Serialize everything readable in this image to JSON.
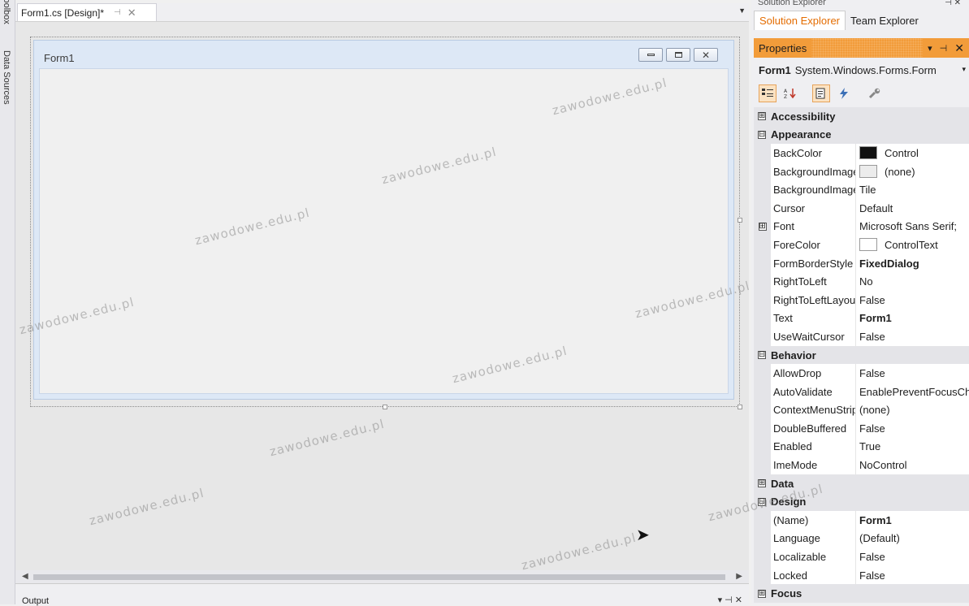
{
  "left_strip": {
    "tab1": "Toolbox",
    "tab2": "Data Sources"
  },
  "document_tab": {
    "title": "Form1.cs [Design]*",
    "pin_glyph": "⊣",
    "close_glyph": "✕",
    "dropdown_glyph": "▼"
  },
  "form": {
    "title": "Form1",
    "minimize_icon": "minimize-icon",
    "maximize_icon": "maximize-icon",
    "close_glyph": "✕"
  },
  "scrollbar": {
    "left_glyph": "◀",
    "right_glyph": "▶"
  },
  "output": {
    "title": "Output",
    "controls": "▾ ⊣ ✕"
  },
  "solution_explorer": {
    "header": "Solution Explorer",
    "header_ctrls": "⊣ ✕",
    "tabs": [
      "Solution Explorer",
      "Team Explorer"
    ]
  },
  "properties": {
    "title": "Properties",
    "header_ctrls": {
      "dropdown": "▾",
      "pin": "⊣",
      "close": "✕"
    },
    "object_name": "Form1",
    "object_type": "System.Windows.Forms.Form",
    "object_arrow": "▾",
    "toolbar": {
      "categorized_icon": "categorized-icon",
      "alphabetical_icon": "alphabetical-icon",
      "properties_icon": "properties-icon",
      "events_icon": "events-icon",
      "property_pages_icon": "wrench-icon"
    },
    "rows": [
      {
        "kind": "cat",
        "name": "Accessibility",
        "expander": "⊞"
      },
      {
        "kind": "cat",
        "name": "Appearance",
        "expander": "⊟"
      },
      {
        "kind": "prop",
        "name": "BackColor",
        "value": "Control",
        "swatch": "black"
      },
      {
        "kind": "prop",
        "name": "BackgroundImage",
        "value": "(none)",
        "swatch": "empty"
      },
      {
        "kind": "prop",
        "name": "BackgroundImageLayout",
        "value": "Tile"
      },
      {
        "kind": "prop",
        "name": "Cursor",
        "value": "Default"
      },
      {
        "kind": "prop",
        "name": "Font",
        "value": "Microsoft Sans Serif;",
        "expandable": true
      },
      {
        "kind": "prop",
        "name": "ForeColor",
        "value": "ControlText",
        "swatch": "white"
      },
      {
        "kind": "prop",
        "name": "FormBorderStyle",
        "value": "FixedDialog",
        "bold": true
      },
      {
        "kind": "prop",
        "name": "RightToLeft",
        "value": "No"
      },
      {
        "kind": "prop",
        "name": "RightToLeftLayout",
        "value": "False"
      },
      {
        "kind": "prop",
        "name": "Text",
        "value": "Form1",
        "bold": true
      },
      {
        "kind": "prop",
        "name": "UseWaitCursor",
        "value": "False"
      },
      {
        "kind": "cat",
        "name": "Behavior",
        "expander": "⊟"
      },
      {
        "kind": "prop",
        "name": "AllowDrop",
        "value": "False"
      },
      {
        "kind": "prop",
        "name": "AutoValidate",
        "value": "EnablePreventFocusChange"
      },
      {
        "kind": "prop",
        "name": "ContextMenuStrip",
        "value": "(none)"
      },
      {
        "kind": "prop",
        "name": "DoubleBuffered",
        "value": "False"
      },
      {
        "kind": "prop",
        "name": "Enabled",
        "value": "True"
      },
      {
        "kind": "prop",
        "name": "ImeMode",
        "value": "NoControl"
      },
      {
        "kind": "cat",
        "name": "Data",
        "expander": "⊞"
      },
      {
        "kind": "cat",
        "name": "Design",
        "expander": "⊟"
      },
      {
        "kind": "prop",
        "name": "(Name)",
        "value": "Form1",
        "bold": true
      },
      {
        "kind": "prop",
        "name": "Language",
        "value": "(Default)"
      },
      {
        "kind": "prop",
        "name": "Localizable",
        "value": "False"
      },
      {
        "kind": "prop",
        "name": "Locked",
        "value": "False"
      },
      {
        "kind": "cat",
        "name": "Focus",
        "expander": "⊞"
      }
    ]
  },
  "watermark": "zawodowe.edu.pl",
  "colors": {
    "accent_orange": "#f29c3a",
    "tab_active_text": "#e46c00"
  }
}
